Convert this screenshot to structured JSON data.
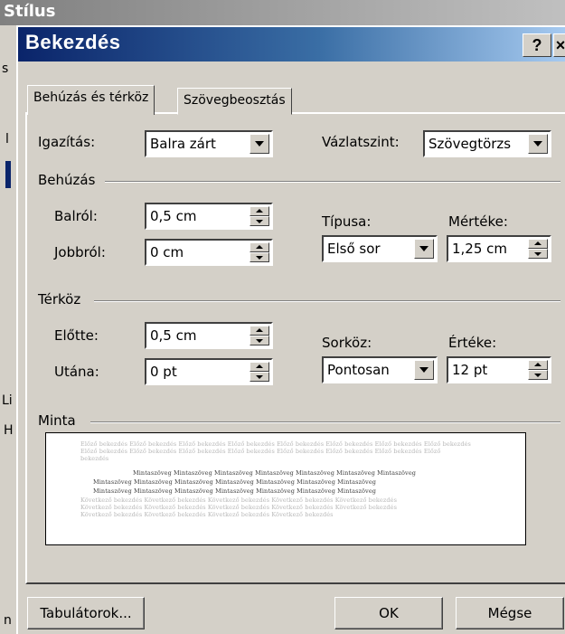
{
  "background": {
    "title_fragment": "Stílus",
    "left_fragments": [
      "s",
      "l",
      "Li",
      "H",
      "n"
    ]
  },
  "dialog": {
    "title": "Bekezdés",
    "help_button": "?",
    "close_button": "×",
    "tabs": [
      {
        "label": "Behúzás és térköz",
        "active": true
      },
      {
        "label": "Szövegbeosztás",
        "active": false
      }
    ],
    "alignment": {
      "label": "Igazítás:",
      "value": "Balra zárt"
    },
    "outline": {
      "label": "Vázlatszint:",
      "value": "Szövegtörzs"
    },
    "indent": {
      "group_label": "Behúzás",
      "left": {
        "label": "Balról:",
        "value": "0,5 cm"
      },
      "right": {
        "label": "Jobbról:",
        "value": "0 cm"
      },
      "special": {
        "label": "Típusa:",
        "value": "Első sor"
      },
      "by": {
        "label": "Mértéke:",
        "value": "1,25 cm"
      }
    },
    "spacing": {
      "group_label": "Térköz",
      "before": {
        "label": "Előtte:",
        "value": "0,5 cm"
      },
      "after": {
        "label": "Utána:",
        "value": "0 pt"
      },
      "line_spacing": {
        "label": "Sorköz:",
        "value": "Pontosan"
      },
      "at": {
        "label": "Értéke:",
        "value": "12 pt"
      }
    },
    "preview": {
      "group_label": "Minta",
      "prev_lines": [
        "Előző bekezdés Előző bekezdés Előző bekezdés Előző bekezdés Előző bekezdés Előző bekezdés Előző bekezdés Előző bekezdés",
        "Előző bekezdés Előző bekezdés Előző bekezdés Előző bekezdés Előző bekezdés Előző bekezdés Előző bekezdés Előző",
        "bekezdés"
      ],
      "sample_lines": [
        "Mintaszöveg Mintaszöveg Mintaszöveg Mintaszöveg Mintaszöveg Mintaszöveg Mintaszöveg",
        "Mintaszöveg Mintaszöveg Mintaszöveg Mintaszöveg Mintaszöveg Mintaszöveg Mintaszöveg",
        "Mintaszöveg Mintaszöveg Mintaszöveg Mintaszöveg Mintaszöveg Mintaszöveg Mintaszöveg"
      ],
      "next_lines": [
        "Következő bekezdés Következő bekezdés Következő bekezdés Következő bekezdés Következő bekezdés",
        "Következő bekezdés Következő bekezdés Következő bekezdés Következő bekezdés Következő bekezdés",
        "Következő bekezdés Következő bekezdés Következő bekezdés Következő bekezdés"
      ]
    },
    "buttons": {
      "tabs": "Tabulátorok...",
      "ok": "OK",
      "cancel": "Mégse"
    }
  }
}
